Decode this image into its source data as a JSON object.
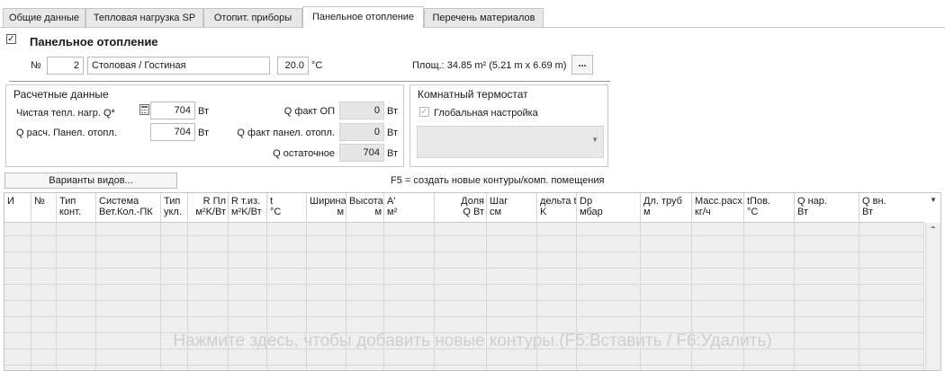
{
  "tabs": [
    {
      "label": "Общие данные",
      "active": false
    },
    {
      "label": "Тепловая нагрузка SP",
      "active": false
    },
    {
      "label": "Отопит. приборы",
      "active": false
    },
    {
      "label": "Панельное отопление",
      "active": true
    },
    {
      "label": "Перечень материалов",
      "active": false
    }
  ],
  "header": {
    "enabled_checked": true,
    "title": "Панельное отопление",
    "no_label": "№",
    "room_number": "2",
    "room_name": "Столовая / Гостиная",
    "temperature": "20.0",
    "temperature_unit": "°C",
    "area_label": "Площ.: 34.85  m² (5.21 m x 6.69 m)",
    "dots_button": "..."
  },
  "calc": {
    "title": "Расчетные данные",
    "net_load_label": "Чистая тепл. нагр. Q*",
    "net_load_value": "704",
    "q_panel_label": "Q расч. Панел. отопл.",
    "q_panel_value": "704",
    "q_fact_op_label": "Q факт ОП",
    "q_fact_op_value": "0",
    "q_fact_panel_label": "Q факт панел. отопл.",
    "q_fact_panel_value": "0",
    "q_rest_label": "Q остаточное",
    "q_rest_value": "704",
    "unit": "Вт"
  },
  "thermostat": {
    "title": "Комнатный термостат",
    "global_label": "Глобальная настройка",
    "global_checked": true,
    "select_value": ""
  },
  "view_variants_button": "Варианты видов...",
  "hint": "F5 = создать новые контуры/комп. помещения",
  "grid": {
    "columns": [
      {
        "l1": "И",
        "l2": ""
      },
      {
        "l1": "№",
        "l2": ""
      },
      {
        "l1": "Тип",
        "l2": "конт."
      },
      {
        "l1": "Система",
        "l2": "Вет.Кол.-ПК"
      },
      {
        "l1": "Тип",
        "l2": "укл."
      },
      {
        "l1": "R Пл",
        "l2": "м²K/Вт"
      },
      {
        "l1": "R т.из.",
        "l2": "м²K/Вт"
      },
      {
        "l1": "t",
        "l2": "°C"
      },
      {
        "l1": "Ширина",
        "l2": "м"
      },
      {
        "l1": "Высота",
        "l2": "м"
      },
      {
        "l1": "A'",
        "l2": "м²"
      },
      {
        "l1": "Доля",
        "l2": "Q Вт"
      },
      {
        "l1": "Шаг",
        "l2": "см"
      },
      {
        "l1": "дельта t",
        "l2": "K"
      },
      {
        "l1": "Dp",
        "l2": "мбар"
      },
      {
        "l1": "Дл. труб",
        "l2": "м"
      },
      {
        "l1": "Масс.расх.",
        "l2": "кг/ч"
      },
      {
        "l1": "tПов.",
        "l2": "°C"
      },
      {
        "l1": "Q нар.",
        "l2": "Вт"
      },
      {
        "l1": "Q вн.",
        "l2": "Вт"
      }
    ],
    "placeholder": "Нажмите здесь, чтобы добавить новые контуры.(F5:Вставить / F6:Удалить)"
  }
}
